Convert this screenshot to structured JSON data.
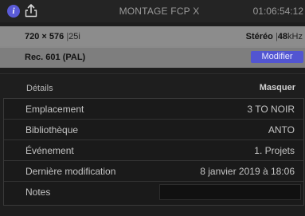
{
  "window": {
    "title": "MONTAGE FCP X",
    "timecode": "01:06:54:12"
  },
  "icons": {
    "info": "info-icon",
    "share": "share-icon",
    "info_glyph": "i",
    "accent_color": "#5a5bd8"
  },
  "format": {
    "video_resolution": "720 × 576",
    "separator": "|",
    "frame_rate": "25i",
    "audio_channels": "Stéréo",
    "audio_rate_value": "48",
    "audio_rate_unit": "kHz",
    "color_space": "Rec. 601 (PAL)",
    "modify_label": "Modifier"
  },
  "details": {
    "section_label": "Détails",
    "hide_label": "Masquer",
    "rows": [
      {
        "label": "Emplacement",
        "value": "3 TO NOIR"
      },
      {
        "label": "Bibliothèque",
        "value": "ANTO"
      },
      {
        "label": "Événement",
        "value": "1. Projets"
      },
      {
        "label": "Dernière modification",
        "value": "8 janvier 2019 à 18:06"
      }
    ],
    "notes_label": "Notes",
    "notes_value": ""
  }
}
